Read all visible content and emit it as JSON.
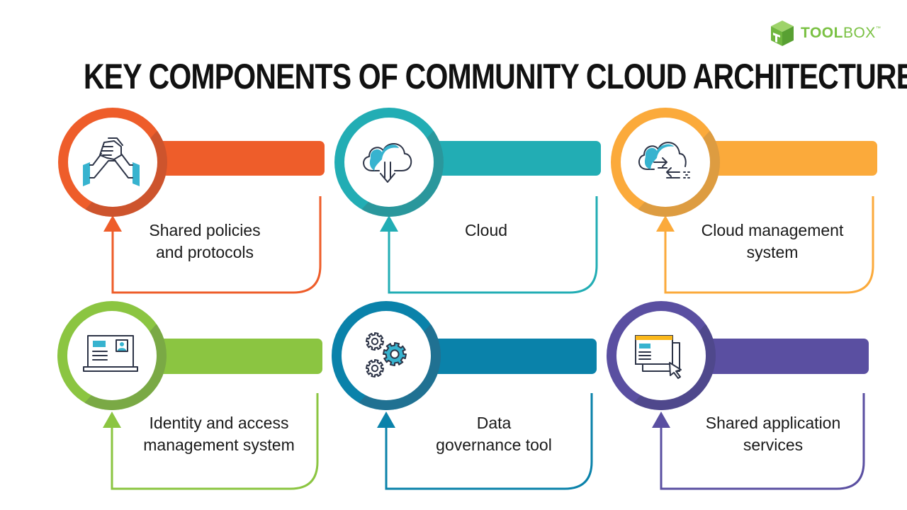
{
  "logo": {
    "brand_bold": "TOOL",
    "brand_light": "BOX",
    "trademark": "™",
    "color": "#7ac143"
  },
  "title": "KEY COMPONENTS OF COMMUNITY CLOUD ARCHITECTURE",
  "components": [
    {
      "label": "Shared policies and protocols",
      "line1": "Shared policies",
      "line2": "and protocols",
      "icon": "handshake-icon",
      "color": "#ee5d2a",
      "shade": "#c9532e"
    },
    {
      "label": "Cloud",
      "line1": "Cloud",
      "line2": "",
      "icon": "cloud-download-icon",
      "color": "#22adb4",
      "shade": "#2b9599"
    },
    {
      "label": "Cloud management system",
      "line1": "Cloud management",
      "line2": "system",
      "icon": "cloud-transfer-icon",
      "color": "#fbaa3b",
      "shade": "#d99a42"
    },
    {
      "label": "Identity and access management system",
      "line1": "Identity and access",
      "line2": "management system",
      "icon": "laptop-id-icon",
      "color": "#8bc541",
      "shade": "#78a546"
    },
    {
      "label": "Data governance tool",
      "line1": "Data",
      "line2": "governance tool",
      "icon": "gears-icon",
      "color": "#0a82aa",
      "shade": "#226f8f"
    },
    {
      "label": "Shared application services",
      "line1": "Shared application",
      "line2": "services",
      "icon": "app-window-cursor-icon",
      "color": "#5a4fa1",
      "shade": "#4e478a"
    }
  ],
  "icon_colors": {
    "stroke": "#2d3447",
    "accent": "#37b3cf",
    "yellow": "#fbb81b"
  }
}
